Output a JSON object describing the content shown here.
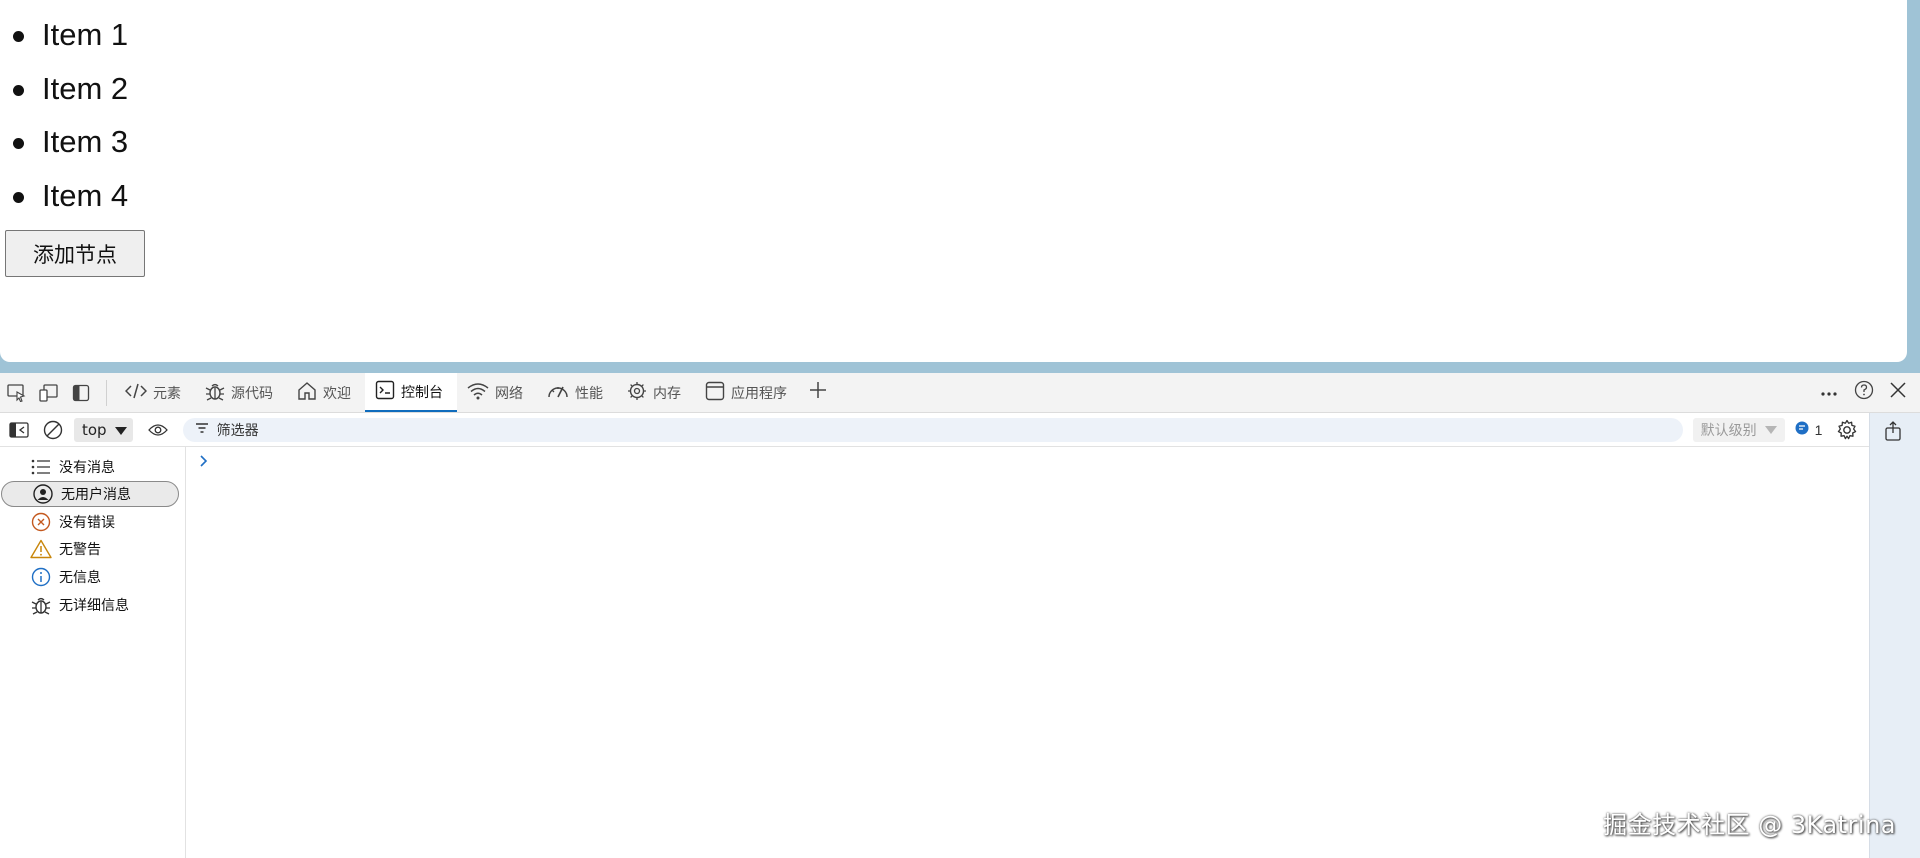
{
  "page": {
    "list_items": [
      "Item 1",
      "Item 2",
      "Item 3",
      "Item 4"
    ],
    "add_button": "添加节点"
  },
  "devtools": {
    "tabs": [
      {
        "label": "元素",
        "icon": "code-icon"
      },
      {
        "label": "源代码",
        "icon": "bug-icon"
      },
      {
        "label": "欢迎",
        "icon": "home-icon"
      },
      {
        "label": "控制台",
        "icon": "console-icon",
        "active": true
      },
      {
        "label": "网络",
        "icon": "wifi-icon"
      },
      {
        "label": "性能",
        "icon": "gauge-icon"
      },
      {
        "label": "内存",
        "icon": "chip-icon"
      },
      {
        "label": "应用程序",
        "icon": "window-icon"
      }
    ],
    "console_toolbar": {
      "context": "top",
      "filter_placeholder": "筛选器",
      "levels": "默认级别",
      "issue_count": "1"
    },
    "sidebar": [
      {
        "label": "没有消息",
        "icon": "list-icon"
      },
      {
        "label": "无用户消息",
        "icon": "user-icon",
        "selected": true
      },
      {
        "label": "没有错误",
        "icon": "error-icon"
      },
      {
        "label": "无警告",
        "icon": "warning-icon"
      },
      {
        "label": "无信息",
        "icon": "info-icon"
      },
      {
        "label": "无详细信息",
        "icon": "bug-icon"
      }
    ],
    "colors": {
      "accent": "#0f6cbd",
      "error": "#c4591f",
      "warning": "#c8860a",
      "info": "#1f6fc5"
    }
  },
  "watermark": "掘金技术社区 @ 3Katrina"
}
